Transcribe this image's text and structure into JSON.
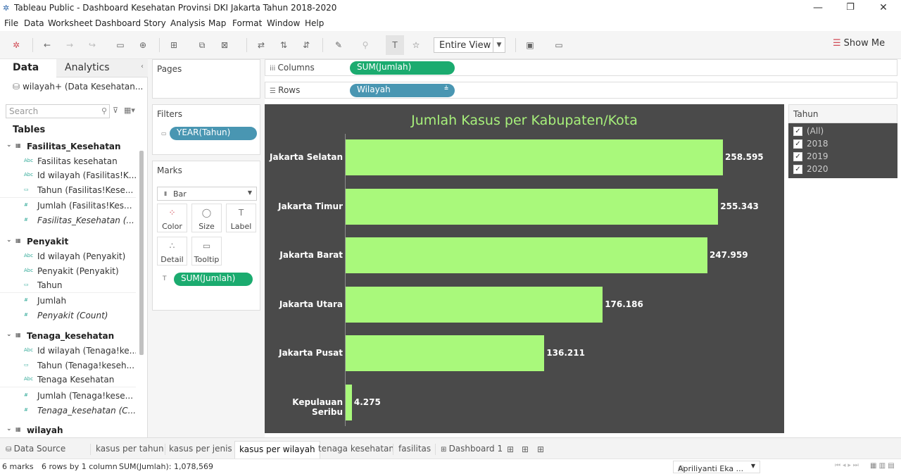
{
  "window": {
    "title": "Tableau Public - Dashboard Kesehatan Provinsi DKI Jakarta Tahun 2018-2020",
    "min": "—",
    "max": "❐",
    "close": "✕"
  },
  "menu": [
    "File",
    "Data",
    "Worksheet",
    "Dashboard",
    "Story",
    "Analysis",
    "Map",
    "Format",
    "Window",
    "Help"
  ],
  "toolbar": {
    "fit": "Entire View",
    "show_me": "Show Me"
  },
  "data_pane": {
    "tab_data": "Data",
    "tab_analytics": "Analytics",
    "datasource": "wilayah+ (Data Kesehatan...",
    "search_placeholder": "Search",
    "tables_heading": "Tables",
    "tables": [
      {
        "name": "Fasilitas_Kesehatan",
        "fields": [
          "Fasilitas kesehatan",
          "Id wilayah (Fasilitas!K...",
          "Tahun (Fasilitas!Kese...",
          "Jumlah (Fasilitas!Kes...",
          "Fasilitas_Kesehatan (..."
        ]
      },
      {
        "name": "Penyakit",
        "fields": [
          "Id wilayah (Penyakit)",
          "Penyakit (Penyakit)",
          "Tahun",
          "Jumlah",
          "Penyakit (Count)"
        ]
      },
      {
        "name": "Tenaga_kesehatan",
        "fields": [
          "Id wilayah (Tenaga!ke...",
          "Tahun (Tenaga!keseh...",
          "Tenaga Kesehatan",
          "Jumlah (Tenaga!kese...",
          "Tenaga_kesehatan (C..."
        ]
      },
      {
        "name": "wilayah",
        "fields": []
      }
    ]
  },
  "cards": {
    "pages": "Pages",
    "filters": "Filters",
    "filter_pill": "YEAR(Tahun)",
    "marks": "Marks",
    "mark_type": "Bar",
    "mark_buttons": [
      "Color",
      "Size",
      "Label",
      "Detail",
      "Tooltip"
    ],
    "marks_pill": "SUM(Jumlah)"
  },
  "shelves": {
    "columns_label": "Columns",
    "columns_pill": "SUM(Jumlah)",
    "rows_label": "Rows",
    "rows_pill": "Wilayah"
  },
  "chart_data": {
    "type": "bar",
    "orientation": "horizontal",
    "title": "Jumlah Kasus per Kabupaten/Kota",
    "categories": [
      "Jakarta Selatan",
      "Jakarta Timur",
      "Jakarta Barat",
      "Jakarta Utara",
      "Jakarta Pusat",
      "Kepulauan Seribu"
    ],
    "values": [
      258595,
      255343,
      247959,
      176186,
      136211,
      4275
    ],
    "value_labels": [
      "258.595",
      "255.343",
      "247.959",
      "176.186",
      "136.211",
      "4.275"
    ],
    "bar_color": "#a9f97b",
    "background": "#4a4a4a",
    "title_color": "#a7f07b",
    "xlim": [
      0,
      258595
    ]
  },
  "quick_filter": {
    "title": "Tahun",
    "options": [
      {
        "label": "(All)",
        "checked": true
      },
      {
        "label": "2018",
        "checked": true
      },
      {
        "label": "2019",
        "checked": true
      },
      {
        "label": "2020",
        "checked": true
      }
    ]
  },
  "sheet_tabs": [
    "Data Source",
    "kasus per tahun",
    "kasus per jenis",
    "kasus per wilayah",
    "tenaga kesehatan",
    "fasilitas",
    "Dashboard 1"
  ],
  "active_tab": "kasus per wilayah",
  "status": {
    "marks": "6 marks",
    "rows": "6 rows by 1 column",
    "sum": "SUM(Jumlah): 1,078,569",
    "user": "Apriliyanti Eka ..."
  }
}
